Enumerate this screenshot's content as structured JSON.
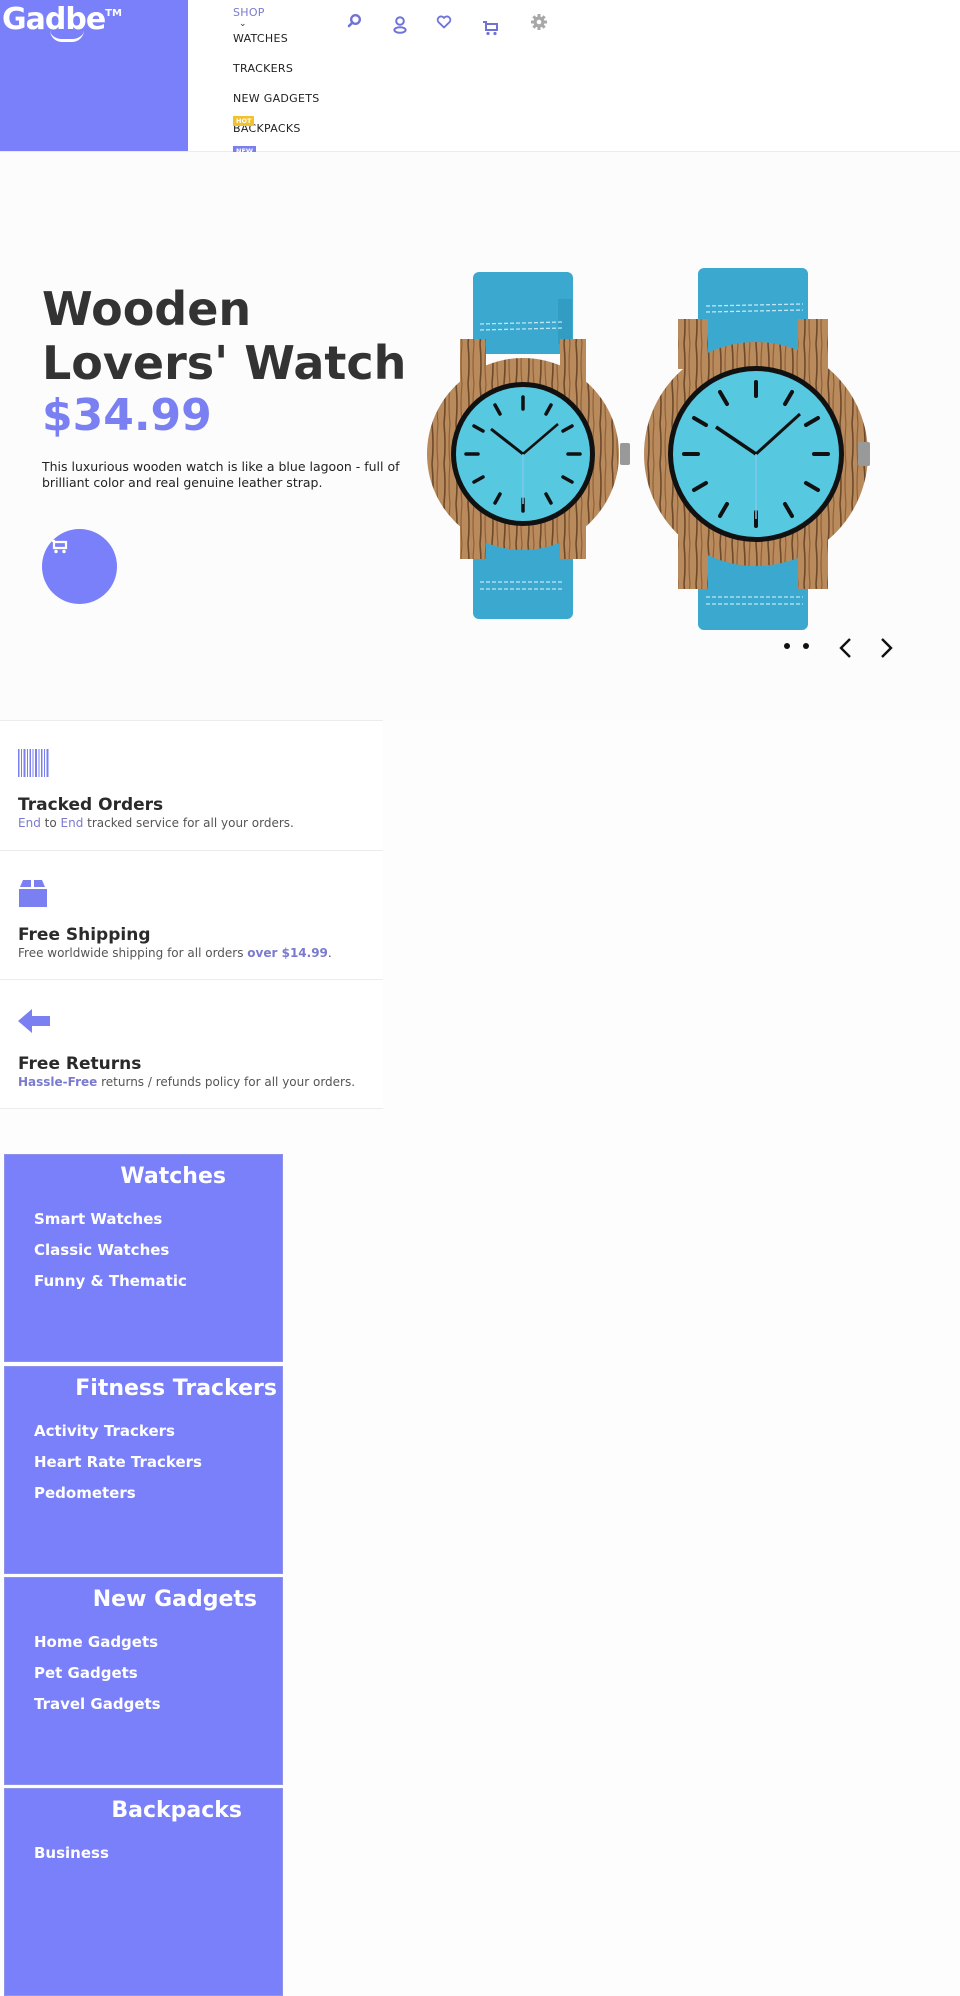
{
  "brand": {
    "name": "Gadbe",
    "trademark": "TM",
    "accent": "#7a7ffa"
  },
  "nav": {
    "shop_label": "SHOP",
    "items": [
      {
        "label": "WATCHES"
      },
      {
        "label": "TRACKERS"
      },
      {
        "label": "NEW GADGETS",
        "badge": "HOT",
        "badge_color": "#f2c12e"
      },
      {
        "label": "BACKPACKS",
        "badge": "NEW",
        "badge_color": "#7a7ff0"
      }
    ],
    "icons": [
      "search-icon",
      "account-icon",
      "wishlist-heart-icon",
      "cart-icon",
      "settings-gear-icon"
    ]
  },
  "hero": {
    "title": "Wooden Lovers' Watch",
    "title_line1": "Wooden",
    "title_line2": "Lovers' Watch",
    "price": "$34.99",
    "description": "This luxurious wooden watch is like a blue lagoon - full of brilliant color and real genuine leather strap.",
    "slides_count": 2,
    "image_alt": "Two wooden watches with turquoise dials and blue leather straps"
  },
  "features": [
    {
      "icon": "barcode-icon",
      "title": "Tracked Orders",
      "text_parts": [
        {
          "t": "End",
          "style": "hl"
        },
        {
          "t": " to ",
          "style": ""
        },
        {
          "t": "End",
          "style": "hl"
        },
        {
          "t": " tracked service for all your orders.",
          "style": ""
        }
      ]
    },
    {
      "icon": "package-box-icon",
      "title": "Free Shipping",
      "text_parts": [
        {
          "t": "Free worldwide shipping for all orders ",
          "style": ""
        },
        {
          "t": "over $14.99",
          "style": "hlb"
        },
        {
          "t": ".",
          "style": ""
        }
      ]
    },
    {
      "icon": "return-arrow-icon",
      "title": "Free Returns",
      "text_parts": [
        {
          "t": "Hassle-Free",
          "style": "hlb"
        },
        {
          "t": " returns / refunds policy for all your orders.",
          "style": ""
        }
      ]
    }
  ],
  "categories": [
    {
      "title": "Watches",
      "links": [
        "Smart Watches",
        "Classic Watches",
        "Funny & Thematic"
      ]
    },
    {
      "title": "Fitness Trackers",
      "links": [
        "Activity Trackers",
        "Heart Rate Trackers",
        "Pedometers"
      ]
    },
    {
      "title": "New Gadgets",
      "links": [
        "Home Gadgets",
        "Pet Gadgets",
        "Travel Gadgets"
      ]
    },
    {
      "title": "Backpacks",
      "links": [
        "Business"
      ]
    }
  ]
}
